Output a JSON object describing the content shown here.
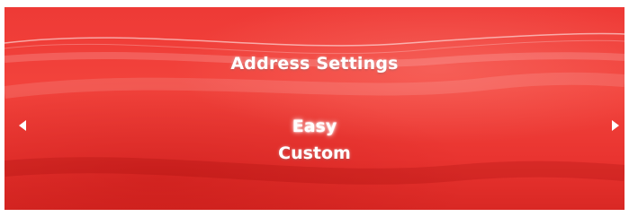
{
  "screen": {
    "title": "Address Settings",
    "theme_color": "#ee3a36"
  },
  "menu": {
    "items": [
      {
        "label": "Easy",
        "selected": true
      },
      {
        "label": "Custom",
        "selected": false
      }
    ]
  },
  "navigation": {
    "left_icon": "left-arrow-icon",
    "right_icon": "right-arrow-icon"
  }
}
